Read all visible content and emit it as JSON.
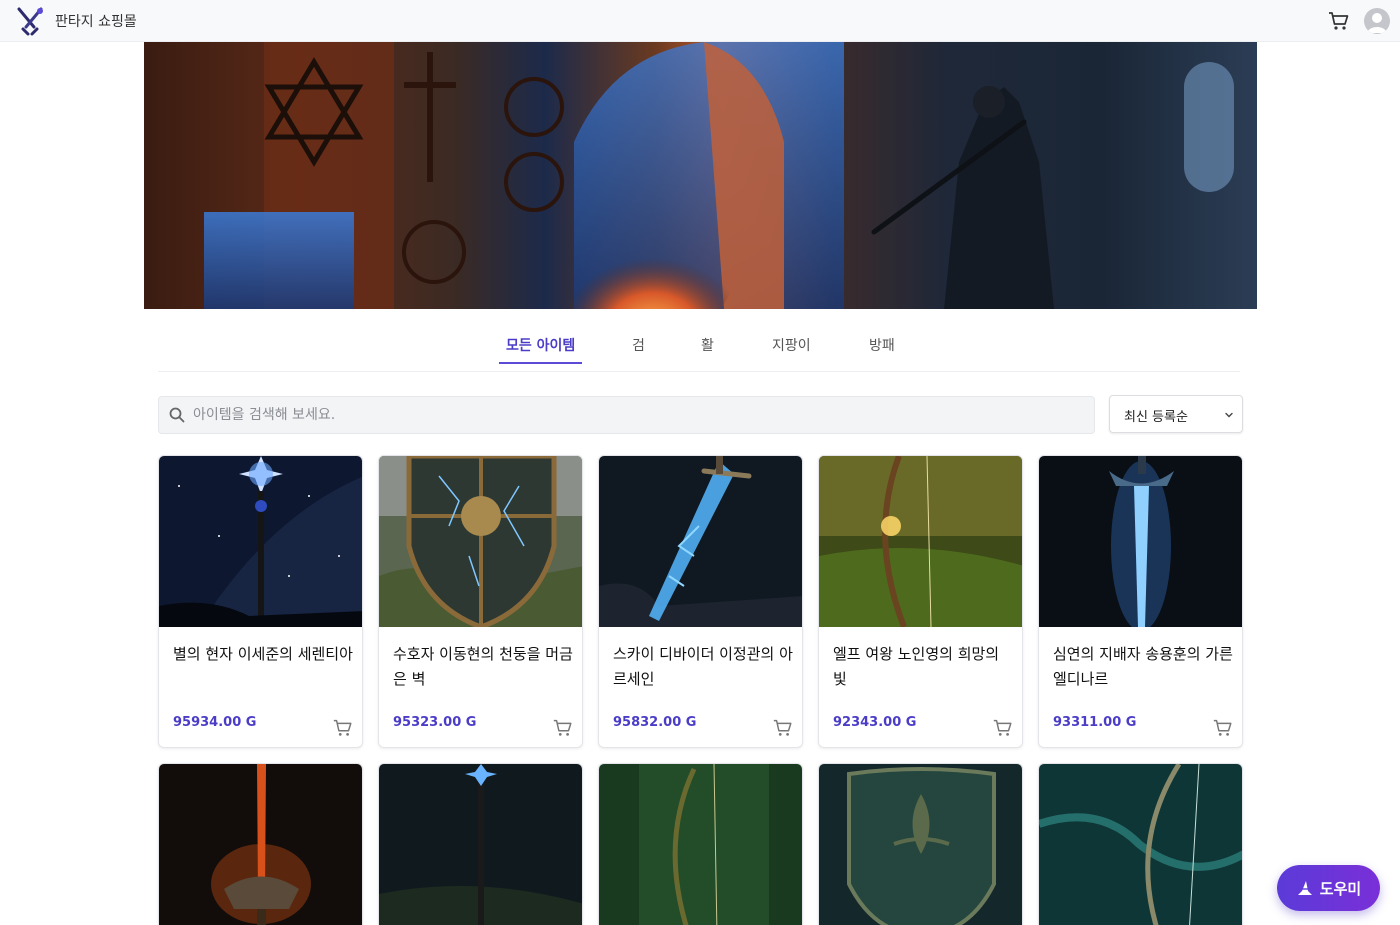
{
  "header": {
    "brand": "판타지 쇼핑몰",
    "icons": {
      "logo": "crossed-swords-logo",
      "cart": "cart-icon",
      "avatar": "user-avatar-icon"
    }
  },
  "tabs": [
    {
      "label": "모든 아이템",
      "active": true
    },
    {
      "label": "검",
      "active": false
    },
    {
      "label": "활",
      "active": false
    },
    {
      "label": "지팡이",
      "active": false
    },
    {
      "label": "방패",
      "active": false
    }
  ],
  "search": {
    "placeholder": "아이템을 검색해 보세요.",
    "value": ""
  },
  "sort": {
    "selected": "최신 등록순"
  },
  "colors": {
    "accent": "#4b3dc7",
    "helper_start": "#5b3bd8",
    "helper_end": "#7a2fd8"
  },
  "products": [
    {
      "title": "별의 현자 이세준의 세렌티아",
      "price": "95934.00 G",
      "kind": "staff"
    },
    {
      "title": "수호자 이동현의 천둥을 머금은 벽",
      "price": "95323.00 G",
      "kind": "shield"
    },
    {
      "title": "스카이 디바이더 이정관의 아르세인",
      "price": "95832.00 G",
      "kind": "sword"
    },
    {
      "title": "엘프 여왕 노인영의 희망의 빛",
      "price": "92343.00 G",
      "kind": "bow"
    },
    {
      "title": "심연의 지배자 송용훈의 가른 엘디나르",
      "price": "93311.00 G",
      "kind": "sword"
    },
    {
      "kind": "sword"
    },
    {
      "kind": "staff"
    },
    {
      "kind": "bow"
    },
    {
      "kind": "shield"
    },
    {
      "kind": "bow"
    }
  ],
  "helper": {
    "label": "도우미",
    "icon": "wizard-hat-icon"
  }
}
